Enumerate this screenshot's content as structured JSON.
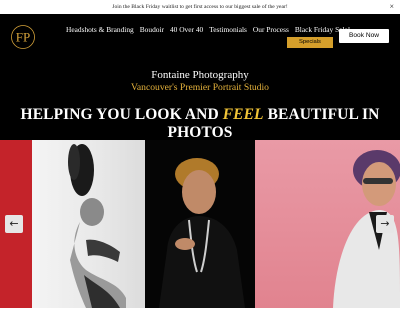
{
  "announcement": {
    "text": "Join the Black Friday waitlist to get first access to our biggest sale of the year!",
    "close": "×"
  },
  "header": {
    "logo_letters": "FP",
    "nav": [
      "Headshots & Branding",
      "Boudoir",
      "40 Over 40",
      "Testimonials",
      "Our Process",
      "Black Friday Sale!"
    ],
    "specials_label": "Specials",
    "book_label": "Book Now"
  },
  "hero": {
    "title": "Fontaine Photography",
    "subtitle": "Vancouver's Premier Portrait Studio",
    "headline_pre": "HELPING YOU LOOK AND ",
    "headline_accent": "FEEL",
    "headline_post": " BEAUTIFUL IN PHOTOS"
  },
  "gallery": {
    "prev": "←",
    "next": "→"
  },
  "colors": {
    "accent": "#e6b33c",
    "specials_bg": "#d59f2b",
    "red": "#c4232a",
    "pink": "#e99aa6"
  }
}
